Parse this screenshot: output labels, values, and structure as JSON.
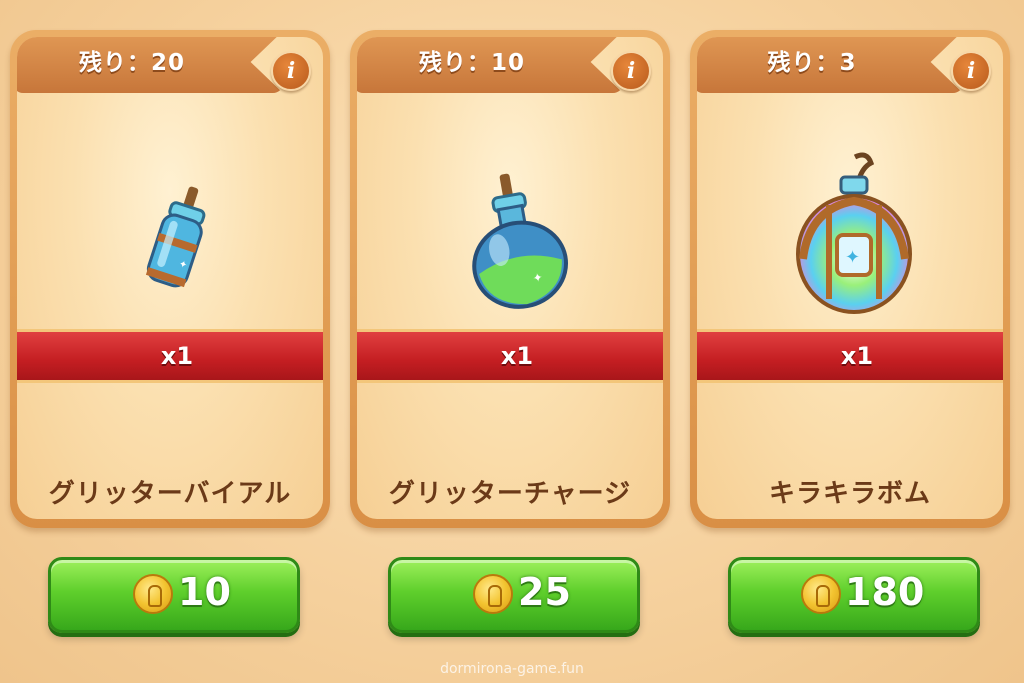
{
  "cards": [
    {
      "remaining": "残り：20",
      "info": "i",
      "quantity": "x1",
      "name": "グリッターバイアル",
      "price": "10",
      "icon": "glitter-vial-icon"
    },
    {
      "remaining": "残り：10",
      "info": "i",
      "quantity": "x1",
      "name": "グリッターチャージ",
      "price": "25",
      "icon": "glitter-charge-potion-icon"
    },
    {
      "remaining": "残り：3",
      "info": "i",
      "quantity": "x1",
      "name": "キラキラボム",
      "price": "180",
      "icon": "kirakira-bomb-icon"
    }
  ],
  "watermark": "dormirona-game.fun",
  "colors": {
    "ribbon": "#c41e22",
    "button": "#5fcf2c",
    "card_border": "#d98f45"
  }
}
